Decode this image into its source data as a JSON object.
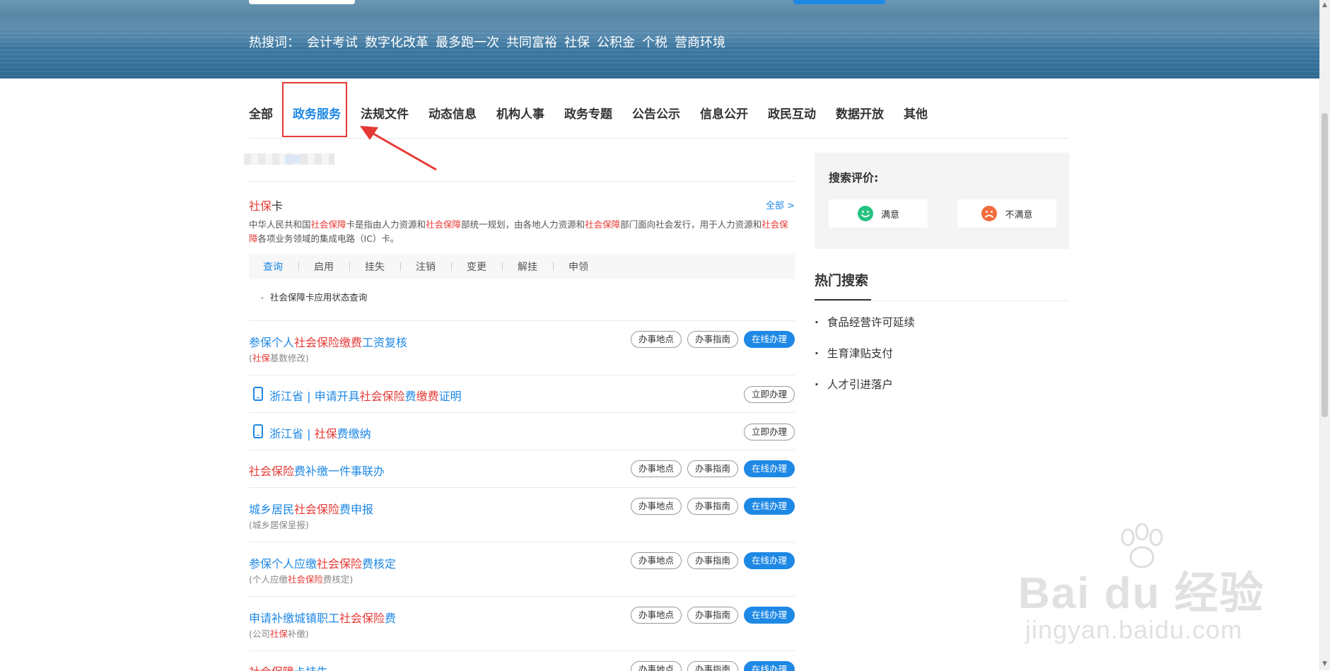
{
  "banner": {
    "hot_words_label": "热搜词：",
    "hot_words": [
      "会计考试",
      "数字化改革",
      "最多跑一次",
      "共同富裕",
      "社保",
      "公积金",
      "个税",
      "营商环境"
    ]
  },
  "tabs": [
    "全部",
    "政务服务",
    "法规文件",
    "动态信息",
    "机构人事",
    "政务专题",
    "公告公示",
    "信息公开",
    "政民互动",
    "数据开放",
    "其他"
  ],
  "card": {
    "title_kw": "社保",
    "title_rest": "卡",
    "all_link": "全部 >",
    "desc": {
      "p1": "中华人民共和国",
      "k1": "社会保障",
      "p2": "卡是指由人力资源和",
      "k2": "社会保障",
      "p3": "部统一规划，由各地人力资源和",
      "k3": "社会保障",
      "p4": "部门面向社会发行，用于人力资源和",
      "k4": "社会保障",
      "p5": "各项业务领域的集成电路（IC）卡。"
    },
    "subtabs": [
      "查询",
      "启用",
      "挂失",
      "注销",
      "变更",
      "解挂",
      "申领"
    ],
    "subitem": "社会保障卡应用状态查询"
  },
  "rows": [
    {
      "t1": "参保个人",
      "k1": "社会保险缴费",
      "t2": "工资复核",
      "sub_pre": "(",
      "sub_kw": "社保",
      "sub_post": "基数修改)",
      "btn1": "办事地点",
      "btn2": "办事指南",
      "btn3": "在线办理"
    },
    {
      "t1": "浙江省 | 申请开具",
      "k1": "社会保险",
      "t2": "费",
      "k2": "缴费",
      "t3": "证明",
      "btn": "立即办理"
    },
    {
      "t1": "浙江省 | ",
      "k1": "社保",
      "t2": "费缴纳",
      "btn": "立即办理"
    },
    {
      "k1": "社会保险",
      "t2": "费补缴一件事联办",
      "btn1": "办事地点",
      "btn2": "办事指南",
      "btn3": "在线办理"
    },
    {
      "t1": "城乡居民",
      "k1": "社会保险",
      "t2": "费申报",
      "sub": "(城乡居保呈报)",
      "btn1": "办事地点",
      "btn2": "办事指南",
      "btn3": "在线办理"
    },
    {
      "t1": "参保个人应缴",
      "k1": "社会保险",
      "t2": "费核定",
      "sub_pre": "(个人应缴",
      "sub_kw": "社会保险",
      "sub_post": "费核定)",
      "btn1": "办事地点",
      "btn2": "办事指南",
      "btn3": "在线办理"
    },
    {
      "t1": "申请补缴城镇职工",
      "k1": "社会保险",
      "t2": "费",
      "sub_pre": "(公司",
      "sub_kw": "社保",
      "sub_post": "补缴)",
      "btn1": "办事地点",
      "btn2": "办事指南",
      "btn3": "在线办理"
    },
    {
      "k1": "社会保障",
      "t2": "卡挂失",
      "btn1": "办事地点",
      "btn2": "办事指南",
      "btn3": "在线办理"
    }
  ],
  "evaluation": {
    "title": "搜索评价:",
    "good": "满意",
    "bad": "不满意"
  },
  "hot_search": {
    "title": "热门搜索",
    "items": [
      "食品经营许可延续",
      "生育津贴支付",
      "人才引进落户"
    ]
  },
  "watermark": {
    "line1": "Bai du 经验",
    "line2": "jingyan.baidu.com"
  },
  "colors": {
    "accent": "#1e88e5",
    "keyword": "#e53935",
    "annotation": "#e53935"
  }
}
